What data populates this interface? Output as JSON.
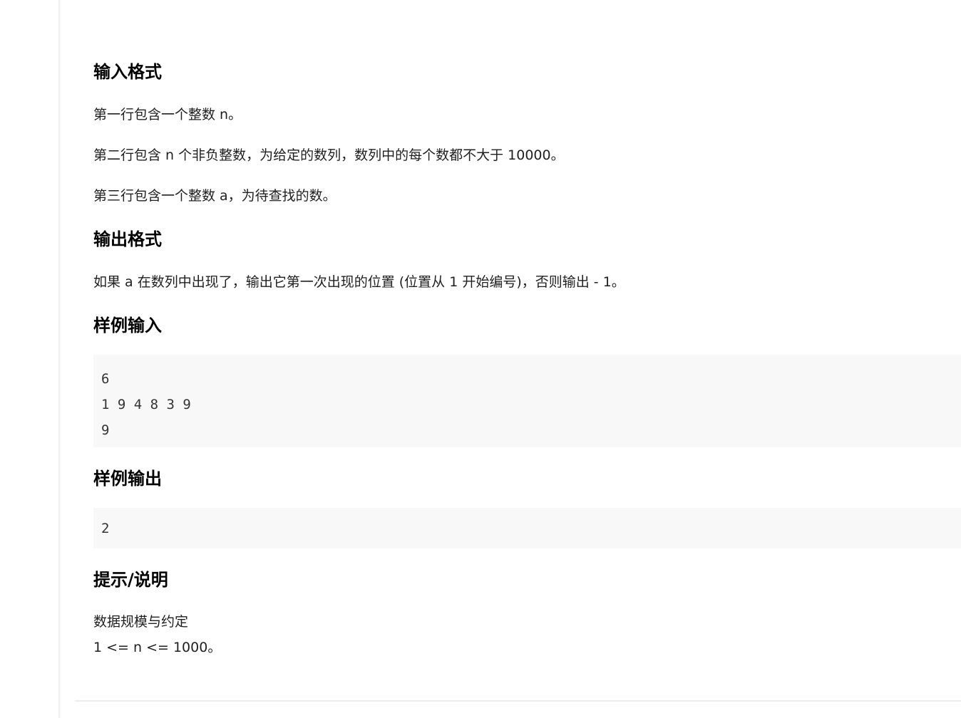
{
  "sections": {
    "input_format": {
      "heading": "输入格式",
      "lines": [
        "第一行包含一个整数 n。",
        "第二行包含 n 个非负整数，为给定的数列，数列中的每个数都不大于 10000。",
        "第三行包含一个整数 a，为待查找的数。"
      ]
    },
    "output_format": {
      "heading": "输出格式",
      "lines": [
        "如果 a 在数列中出现了，输出它第一次出现的位置 (位置从 1 开始编号)，否则输出 - 1。"
      ]
    },
    "sample_input": {
      "heading": "样例输入",
      "code_lines": [
        "6",
        "1 9 4 8 3 9",
        "9"
      ]
    },
    "sample_output": {
      "heading": "样例输出",
      "code_lines": [
        "2"
      ]
    },
    "hint": {
      "heading": "提示/说明",
      "lines": [
        "数据规模与约定",
        "1 <= n <= 1000。"
      ]
    }
  }
}
